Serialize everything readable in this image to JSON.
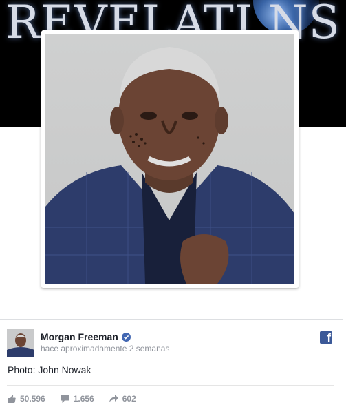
{
  "cover": {
    "title": "REVELATI  NS",
    "icon": "planet-icon"
  },
  "post": {
    "author": "Morgan Freeman",
    "verified_icon": "verified-badge-icon",
    "time": "hace aproximadamente 2 semanas",
    "text": "Photo: John Nowak",
    "platform_icon": "facebook-icon",
    "likes": "50.596",
    "comments": "1.656",
    "shares": "602"
  },
  "colors": {
    "cover_bg": "#000000",
    "facebook_blue": "#3b5998",
    "verified_blue": "#4267b2",
    "muted_text": "#90949c"
  }
}
